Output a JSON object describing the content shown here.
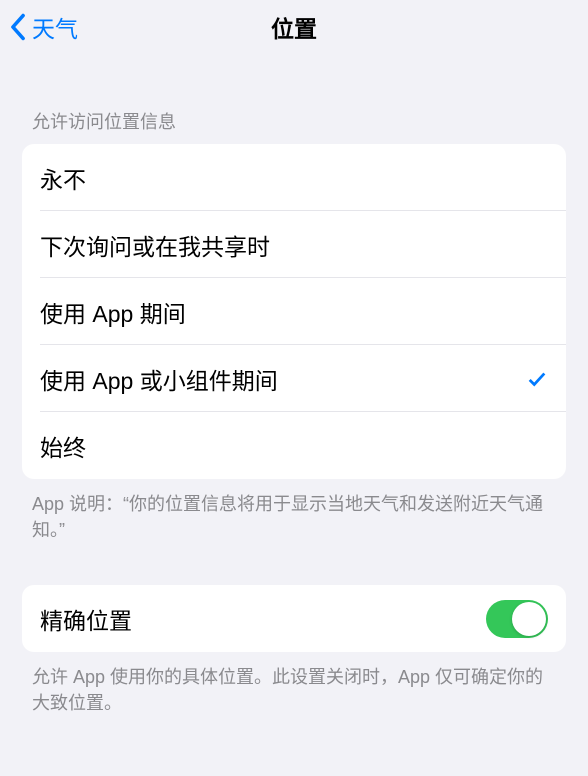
{
  "header": {
    "back_label": "天气",
    "title": "位置"
  },
  "location_access": {
    "section_label": "允许访问位置信息",
    "options": [
      {
        "label": "永不",
        "selected": false
      },
      {
        "label": "下次询问或在我共享时",
        "selected": false
      },
      {
        "label": "使用 App 期间",
        "selected": false
      },
      {
        "label": "使用 App 或小组件期间",
        "selected": true
      },
      {
        "label": "始终",
        "selected": false
      }
    ],
    "footer": "App 说明：“你的位置信息将用于显示当地天气和发送附近天气通知。”"
  },
  "precise": {
    "label": "精确位置",
    "enabled": true,
    "footer": "允许 App 使用你的具体位置。此设置关闭时，App 仅可确定你的大致位置。"
  }
}
